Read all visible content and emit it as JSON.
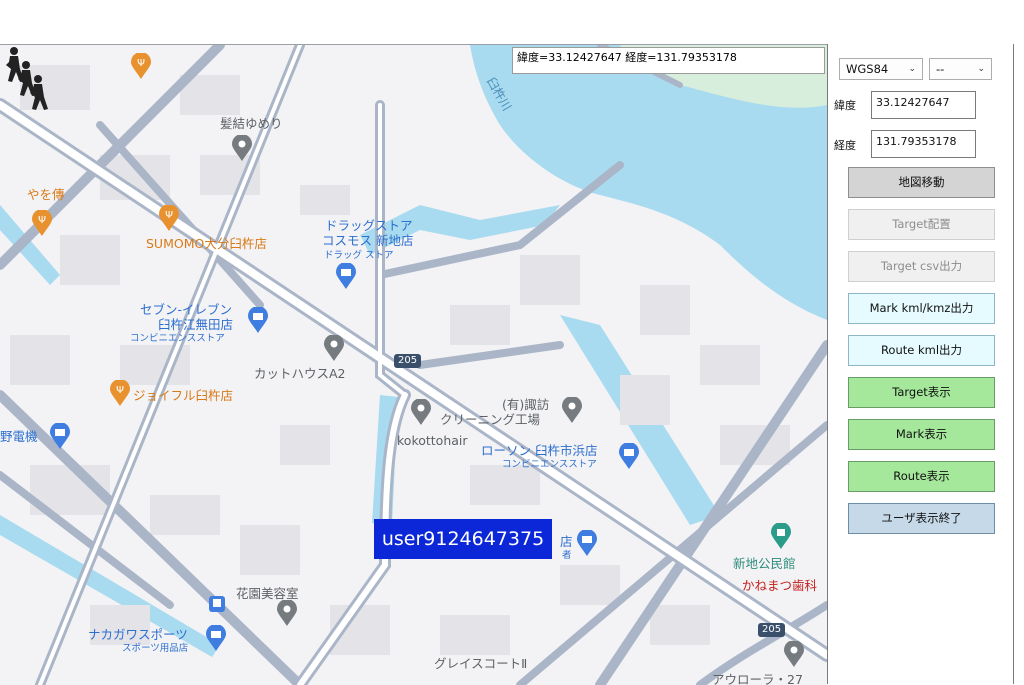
{
  "coordinate_readout": "緯度=33.12427647 経度=131.79353178",
  "user_label": "user9124647375",
  "map": {
    "pois": {
      "kamiyui": "髪結ゆめり",
      "yaden": "やを傳",
      "sumomo": "SUMOMO大分臼杵店",
      "drugstore_line1": "ドラッグストア",
      "drugstore_line2": "コスモス 新地店",
      "drugstore_sub": "ドラッグ ストア",
      "seven_line1": "セブン-イレブン",
      "seven_line2": "臼杵江無田店",
      "seven_sub": "コンビニエンスストア",
      "cuthouse": "カットハウスA2",
      "joyfull": "ジョイフル臼杵店",
      "suwa_line1": "(有)諏訪",
      "suwa_line2": "クリーニング工場",
      "kokotto": "kokottohair",
      "lawson": "ローソン 臼杵市浜店",
      "lawson_sub": "コンビニエンスストア",
      "denki": "野電機",
      "shinchi_kominkan": "新地公民館",
      "kanematsu": "かねまつ歯科",
      "kaen": "花園美容室",
      "nakagawa": "ナカガワスポーツ",
      "nakagawa_sub": "スポーツ用品店",
      "grace": "グレイスコートⅡ",
      "aurora": "アウローラ・27",
      "partial_store": "店",
      "partial_store_sub": "者",
      "river": "臼杵川",
      "route_205_a": "205",
      "route_205_b": "205"
    }
  },
  "panel": {
    "datum_select": "WGS84",
    "second_select": "--",
    "lat_label": "緯度",
    "lat_value": "33.12427647",
    "lon_label": "経度",
    "lon_value": "131.79353178",
    "buttons": {
      "map_move": "地図移動",
      "target_place": "Target配置",
      "target_csv": "Target csv出力",
      "mark_kml": "Mark kml/kmz出力",
      "route_kml": "Route kml出力",
      "target_show": "Target表示",
      "mark_show": "Mark表示",
      "route_show": "Route表示",
      "user_end": "ユーザ表示終了"
    }
  },
  "colors": {
    "water": "#a8daf0",
    "road": "#aab6c8",
    "building": "#e4e4e8",
    "user_label_bg": "#0b27d8",
    "btn_green": "#a5e89c",
    "btn_cyan": "#e6fbff",
    "btn_blue": "#c5d9e8"
  }
}
